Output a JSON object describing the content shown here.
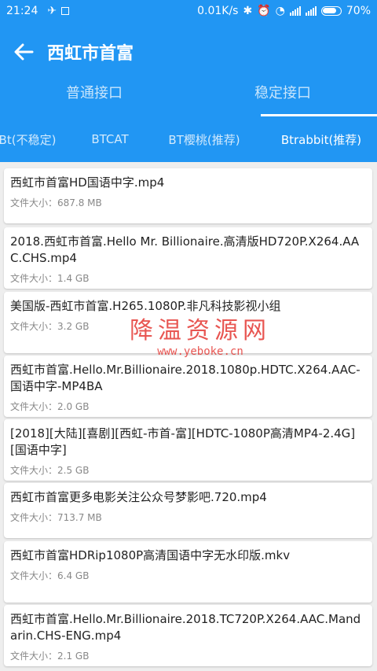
{
  "status_bar": {
    "time": "21:24",
    "speed": "0.01K/s",
    "battery": "70%",
    "icons": [
      "airplane-icon",
      "notification-icon",
      "bluetooth-icon",
      "alarm-icon",
      "wifi-icon",
      "signal-icon",
      "signal-icon",
      "battery-icon"
    ]
  },
  "toolbar": {
    "back_icon": "arrow-left-icon",
    "title": "西虹市首富"
  },
  "tabs_primary": [
    {
      "label": "普通接口",
      "active": false
    },
    {
      "label": "稳定接口",
      "active": true
    }
  ],
  "tabs_secondary": [
    {
      "label": "Bt(不稳定)",
      "active": false
    },
    {
      "label": "BTCAT",
      "active": false
    },
    {
      "label": "BT樱桃(推荐)",
      "active": false
    },
    {
      "label": "Btrabbit(推荐)",
      "active": true
    }
  ],
  "files": [
    {
      "name": "西虹市首富HD国语中字.mp4",
      "size": "文件大小：687.8 MB"
    },
    {
      "name": "2018.西虹市首富.Hello Mr. Billionaire.高清版HD720P.X264.AAC.CHS.mp4",
      "size": "文件大小：1.4 GB"
    },
    {
      "name": "美国版-西虹市首富.H265.1080P.非凡科技影视小组",
      "size": "文件大小：3.2 GB"
    },
    {
      "name": "西虹市首富.Hello.Mr.Billionaire.2018.1080p.HDTC.X264.AAC-国语中字-MP4BA",
      "size": "文件大小：2.0 GB"
    },
    {
      "name": "[2018][大陆][喜剧][西虹-市首-富][HDTC-1080P高清MP4-2.4G][国语中字]",
      "size": "文件大小：2.5 GB"
    },
    {
      "name": "西虹市首富更多电影关注公众号梦影吧.720.mp4",
      "size": "文件大小：713.7 MB"
    },
    {
      "name": "西虹市首富HDRip1080P高清国语中字无水印版.mkv",
      "size": "文件大小：6.4 GB"
    },
    {
      "name": "西虹市首富.Hello.Mr.Billionaire.2018.TC720P.X264.AAC.Mandarin.CHS-ENG.mp4",
      "size": "文件大小：2.1 GB"
    }
  ],
  "watermark": {
    "line1": "降温资源网",
    "line2": "www.yeboke.cn"
  },
  "colors": {
    "primary": "#2196f3",
    "watermark": "#e53935"
  }
}
